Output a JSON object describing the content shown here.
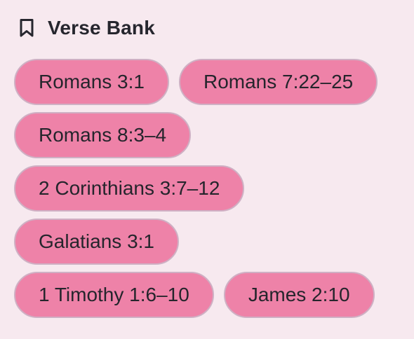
{
  "header": {
    "icon": "bookmark-icon",
    "title": "Verse Bank"
  },
  "colors": {
    "background": "#f7e9ef",
    "chip_fill": "#ee82a8",
    "chip_border": "#cfb0c4",
    "text": "#25252c"
  },
  "verses": {
    "row1": [
      "Romans 3:1",
      "Romans 7:22–25"
    ],
    "row2": [
      "Romans 8:3–4"
    ],
    "row3": [
      "2 Corinthians 3:7–12"
    ],
    "row4": [
      "Galatians 3:1"
    ],
    "row5": [
      "1 Timothy 1:6–10",
      "James 2:10"
    ]
  }
}
